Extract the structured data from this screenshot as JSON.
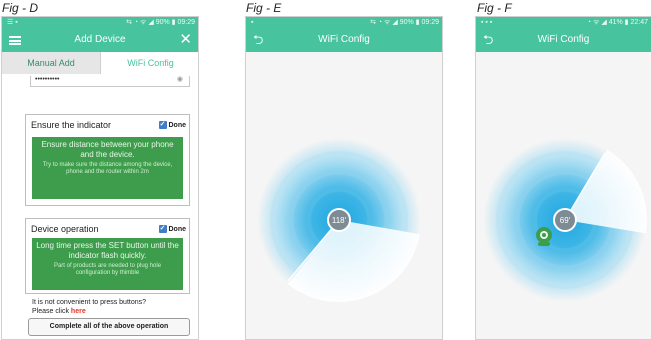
{
  "figures": {
    "d": {
      "label": "Fig - D",
      "status": {
        "left": "☰ ▪",
        "right": "⇆ ◔ ᯤ ◢ 90% ▮ 09:29"
      },
      "title": "Add Device",
      "tabs": {
        "manual": "Manual Add",
        "wifi": "WiFi Config"
      },
      "password_value": "••••••••••",
      "card1": {
        "title": "Ensure the indicator",
        "done": "Done",
        "main": "Ensure distance between your phone and the device.",
        "sub": "Try to make sure the distance among the device, phone and the router within 2m"
      },
      "card2": {
        "title": "Device operation",
        "done": "Done",
        "main": "Long time press the SET button until the indicator flash quickly.",
        "sub": "Part of products are needed to plug hole configuration by thimble"
      },
      "inconvenient_text": "It is not convenient to press buttons?",
      "please_click": "Please click",
      "here_link": "here",
      "complete_button": "Complete all of the above operation"
    },
    "e": {
      "label": "Fig - E",
      "status": {
        "left": "▪",
        "right": "⇆ ◔ ᯤ ◢ 90% ▮ 09:29"
      },
      "title": "WiFi Config",
      "angle_text": "118'",
      "sweep_level": 0.33
    },
    "f": {
      "label": "Fig - F",
      "status": {
        "left": "▪ ▪ ▪",
        "right": "◔ ᯤ ◢ 41% ▮ 22:47"
      },
      "title": "WiFi Config",
      "angle_text": "69'",
      "sweep_level": 0.19
    }
  },
  "colors": {
    "accent_green": "#47c39d",
    "instruction_green": "#3e9d4c",
    "radar_blue": "#1fa7e0",
    "link_red": "#e0342a"
  }
}
